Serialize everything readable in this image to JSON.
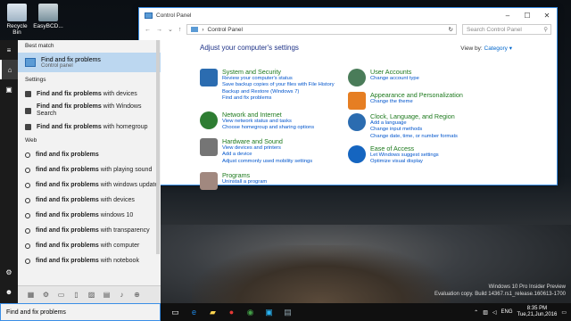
{
  "desktop": {
    "icons": [
      {
        "label": "Recycle Bin",
        "icon": "recycle-bin-icon"
      },
      {
        "label": "EasyBCD...",
        "icon": "easybcd-icon"
      }
    ],
    "watermark": {
      "line1": "Windows 10 Pro Insider Preview",
      "line2": "Evaluation copy. Build 14367.rs1_release.160613-1700"
    }
  },
  "control_panel": {
    "title": "Control Panel",
    "address": "Control Panel",
    "search_placeholder": "Search Control Panel",
    "heading": "Adjust your computer's settings",
    "view_by_label": "View by:",
    "view_by_value": "Category",
    "categories_left": [
      {
        "title": "System and Security",
        "icon": "shield-icon",
        "color": "#2b6cb0",
        "links": [
          "Review your computer's status",
          "Save backup copies of your files with File History",
          "Backup and Restore (Windows 7)",
          "Find and fix problems"
        ]
      },
      {
        "title": "Network and Internet",
        "icon": "globe-icon",
        "color": "#2e7d32",
        "links": [
          "View network status and tasks",
          "Choose homegroup and sharing options"
        ]
      },
      {
        "title": "Hardware and Sound",
        "icon": "printer-icon",
        "color": "#666666",
        "links": [
          "View devices and printers",
          "Add a device",
          "Adjust commonly used mobility settings"
        ]
      },
      {
        "title": "Programs",
        "icon": "programs-icon",
        "color": "#8d6e63",
        "links": [
          "Uninstall a program"
        ]
      }
    ],
    "categories_right": [
      {
        "title": "User Accounts",
        "icon": "users-icon",
        "color": "#4a7c59",
        "links": [
          "Change account type"
        ]
      },
      {
        "title": "Appearance and Personalization",
        "icon": "display-icon",
        "color": "#e67e22",
        "links": [
          "Change the theme"
        ]
      },
      {
        "title": "Clock, Language, and Region",
        "icon": "clock-icon",
        "color": "#2b6cb0",
        "links": [
          "Add a language",
          "Change input methods",
          "Change date, time, or number formats"
        ]
      },
      {
        "title": "Ease of Access",
        "icon": "accessibility-icon",
        "color": "#1565c0",
        "links": [
          "Let Windows suggest settings",
          "Optimize visual display"
        ]
      }
    ]
  },
  "start_menu": {
    "best_match_header": "Best match",
    "best_match": {
      "title": "Find and fix problems",
      "subtitle": "Control panel"
    },
    "settings_header": "Settings",
    "settings": [
      {
        "bold": "Find and fix problems",
        "rest": " with devices"
      },
      {
        "bold": "Find and fix problems",
        "rest": " with Windows Search"
      },
      {
        "bold": "Find and fix problems",
        "rest": " with homegroup"
      }
    ],
    "web_header": "Web",
    "web": [
      {
        "bold": "find and fix problems",
        "rest": ""
      },
      {
        "bold": "find and fix problems",
        "rest": " with playing sound"
      },
      {
        "bold": "find and fix problems",
        "rest": " with windows update"
      },
      {
        "bold": "find and fix problems",
        "rest": " with devices"
      },
      {
        "bold": "find and fix problems",
        "rest": " windows 10"
      },
      {
        "bold": "find and fix problems",
        "rest": " with transparency"
      },
      {
        "bold": "find and fix problems",
        "rest": " with computer"
      },
      {
        "bold": "find and fix problems",
        "rest": " with notebook"
      }
    ]
  },
  "taskbar": {
    "search_text": "Find and fix problems",
    "lang": "ENG",
    "time": "8:35 PM",
    "date": "Tue,21,Jun,2016"
  }
}
